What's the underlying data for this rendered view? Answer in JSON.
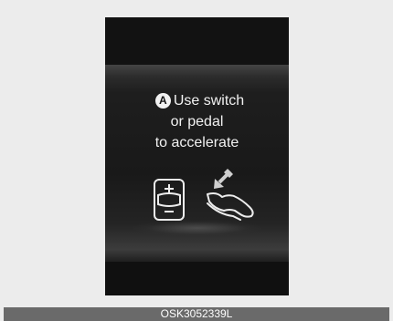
{
  "display": {
    "badge": "A",
    "message_line1": "Use switch",
    "message_line2": "or pedal",
    "message_line3": "to accelerate"
  },
  "icons": {
    "switch": "plus-minus-switch-icon",
    "pedal": "accelerator-pedal-icon"
  },
  "caption": "OSK3052339L",
  "colors": {
    "background": "#ececec",
    "display": "#121212",
    "text": "#f1f1f1",
    "caption_bar": "#6a6a6a"
  }
}
